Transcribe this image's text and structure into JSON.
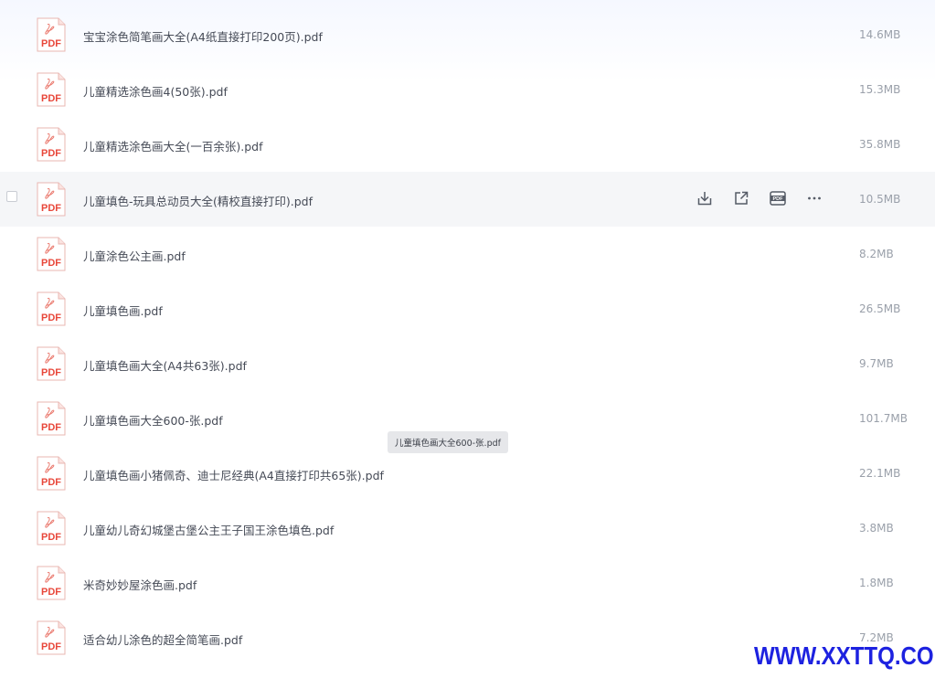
{
  "files": [
    {
      "name": "宝宝涂色简笔画大全(A4纸直接打印200页).pdf",
      "size": "14.6MB"
    },
    {
      "name": "儿童精选涂色画4(50张).pdf",
      "size": "15.3MB"
    },
    {
      "name": "儿童精选涂色画大全(一百余张).pdf",
      "size": "35.8MB"
    },
    {
      "name": "儿童填色-玩具总动员大全(精校直接打印).pdf",
      "size": "10.5MB"
    },
    {
      "name": "儿童涂色公主画.pdf",
      "size": "8.2MB"
    },
    {
      "name": "儿童填色画.pdf",
      "size": "26.5MB"
    },
    {
      "name": "儿童填色画大全(A4共63张).pdf",
      "size": "9.7MB"
    },
    {
      "name": "儿童填色画大全600-张.pdf",
      "size": "101.7MB"
    },
    {
      "name": "儿童填色画小猪佩奇、迪士尼经典(A4直接打印共65张).pdf",
      "size": "22.1MB"
    },
    {
      "name": "儿童幼儿奇幻城堡古堡公主王子国王涂色填色.pdf",
      "size": "3.8MB"
    },
    {
      "name": "米奇妙妙屋涂色画.pdf",
      "size": "1.8MB"
    },
    {
      "name": "适合幼儿涂色的超全简笔画.pdf",
      "size": "7.2MB"
    }
  ],
  "hovered_row_index": 3,
  "row_actions": [
    {
      "icon": "download-icon"
    },
    {
      "icon": "share-icon"
    },
    {
      "icon": "pdf-convert-icon",
      "glyph": "PDF"
    },
    {
      "icon": "more-icon"
    }
  ],
  "file_icon_label": "PDF",
  "tooltip": "儿童填色画大全600-张.pdf",
  "watermark": "WWW.XXTTQ.COM",
  "colors": {
    "pdf_red": "#e8473a",
    "hover_bg": "#f5f6f8",
    "watermark": "#1d22e0"
  }
}
